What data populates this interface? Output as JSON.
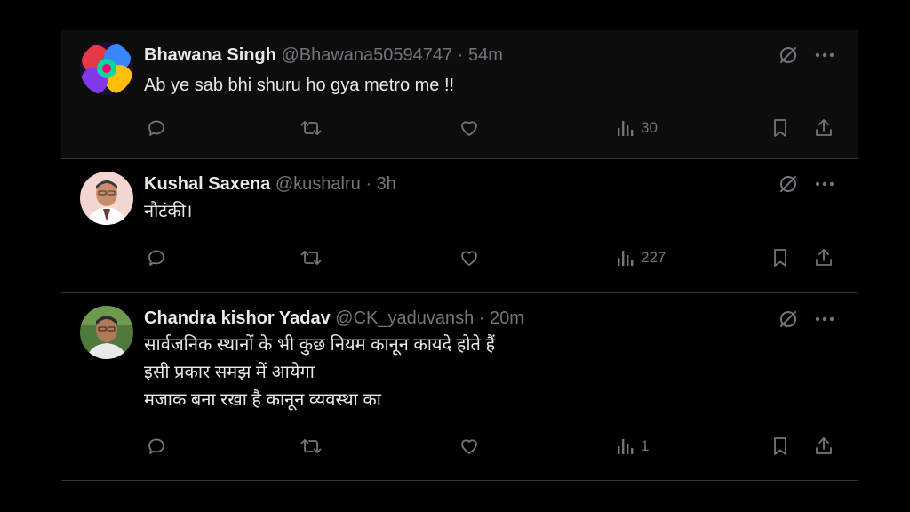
{
  "tweets": [
    {
      "name": "Bhawana Singh",
      "handle": "@Bhawana50594747",
      "dot": "·",
      "time": "54m",
      "text": "Ab ye sab bhi shuru ho gya metro me !!",
      "views": "30"
    },
    {
      "name": "Kushal Saxena",
      "handle": "@kushalru",
      "dot": "·",
      "time": "3h",
      "text": "नौटंकी।",
      "views": "227"
    },
    {
      "name": "Chandra kishor Yadav",
      "handle": "@CK_yaduvansh",
      "dot": "·",
      "time": "20m",
      "text": "सार्वजनिक स्थानों के भी कुछ नियम कानून कायदे होते हैं\nइसी प्रकार समझ में आयेगा\nमजाक बना रखा है कानून व्यवस्था का",
      "views": "1"
    }
  ],
  "icons": {
    "grok": "grok-icon",
    "more": "more-icon",
    "reply": "reply-icon",
    "retweet": "retweet-icon",
    "like": "like-icon",
    "views": "views-icon",
    "bookmark": "bookmark-icon",
    "share": "share-icon"
  },
  "colors": {
    "background": "#000000",
    "text": "#e7e9ea",
    "muted": "#71767b",
    "divider": "#2f3336"
  }
}
